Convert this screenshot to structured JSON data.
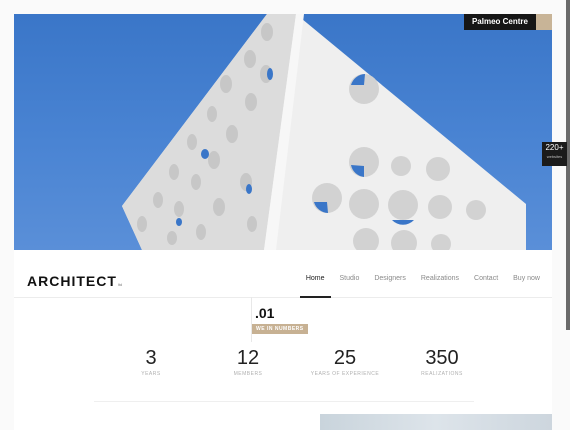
{
  "hero": {
    "caption": "Palmeo Centre",
    "image_icon": "building-photo"
  },
  "header": {
    "logo": "ARCHITECT",
    "logo_suffix": "ltd"
  },
  "nav": {
    "items": [
      {
        "label": "Home",
        "active": true
      },
      {
        "label": "Studio",
        "active": false
      },
      {
        "label": "Designers",
        "active": false
      },
      {
        "label": "Realizations",
        "active": false
      },
      {
        "label": "Contact",
        "active": false
      },
      {
        "label": "Buy now",
        "active": false
      }
    ]
  },
  "section": {
    "number": ".01",
    "badge": "WE IN NUMBERS"
  },
  "stats": [
    {
      "value": "3",
      "label": "YEARS"
    },
    {
      "value": "12",
      "label": "MEMBERS"
    },
    {
      "value": "25",
      "label": "YEARS OF EXPERIENCE"
    },
    {
      "value": "350",
      "label": "REALIZATIONS"
    }
  ],
  "side_badge": {
    "count": "220+",
    "text": "websites"
  },
  "colors": {
    "sky": "#4a84d3",
    "badge": "#c7b193",
    "caption_bg": "#161616",
    "text_dark": "#111111"
  }
}
